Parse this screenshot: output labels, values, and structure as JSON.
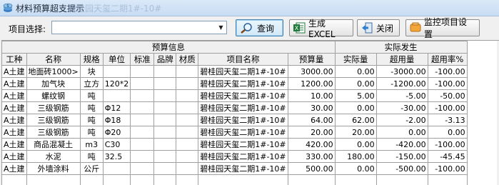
{
  "window": {
    "title": "材料预算超支提示",
    "title_ghost": "碧桂园天玺二期1#-10#"
  },
  "toolbar": {
    "select_label": "项目选择:",
    "select_value": "",
    "query_label": "查询",
    "excel_label": "生成EXCEL",
    "close_label": "关闭",
    "monitor_label": "监控项目设置"
  },
  "table": {
    "group_headers": {
      "budget": "预算信息",
      "actual": "实际发生"
    },
    "columns": [
      "工种",
      "名称",
      "规格",
      "单位",
      "标准",
      "品牌",
      "材质",
      "项目名称",
      "预算量",
      "实际量",
      "超用量",
      "超用率%"
    ],
    "rows": [
      [
        "A土建",
        "地面砖1000>",
        "块",
        "",
        "",
        "",
        "",
        "碧桂园天玺二期1#-10#",
        "3000.00",
        "0.00",
        "-3000.00",
        "-100.00"
      ],
      [
        "A土建",
        "加气块",
        "立方",
        "120*2",
        "",
        "",
        "",
        "碧桂园天玺二期1#-10#",
        "1200.00",
        "0.00",
        "-1200.00",
        "-100.00"
      ],
      [
        "A土建",
        "螺纹钢",
        "吨",
        "",
        "",
        "",
        "",
        "碧桂园天玺二期1#-10#",
        "10.00",
        "5.00",
        "-5.00",
        "-50.00"
      ],
      [
        "A土建",
        "三级钢筋",
        "吨",
        "Φ12",
        "",
        "",
        "",
        "碧桂园天玺二期1#-10#",
        "30.00",
        "0.00",
        "-30.00",
        "-100.00"
      ],
      [
        "A土建",
        "三级钢筋",
        "吨",
        "Φ18",
        "",
        "",
        "",
        "碧桂园天玺二期1#-10#",
        "64.00",
        "62.00",
        "-2.00",
        "-3.13"
      ],
      [
        "A土建",
        "三级钢筋",
        "吨",
        "Φ20",
        "",
        "",
        "",
        "碧桂园天玺二期1#-10#",
        "20.00",
        "20.00",
        "0.00",
        "0.00"
      ],
      [
        "A土建",
        "商品混凝土",
        "m3",
        "C30",
        "",
        "",
        "",
        "碧桂园天玺二期1#-10#",
        "420.00",
        "0.00",
        "-420.00",
        "-100.00"
      ],
      [
        "A土建",
        "水泥",
        "吨",
        "32.5",
        "",
        "",
        "",
        "碧桂园天玺二期1#-10#",
        "330.00",
        "180.00",
        "-150.00",
        "-45.45"
      ],
      [
        "A土建",
        "外墙涂料",
        "公斤",
        "",
        "",
        "",
        "",
        "碧桂园天玺二期1#-10#",
        "500.00",
        "0.00",
        "-500.00",
        "-100.00"
      ],
      [
        "",
        "",
        "",
        "",
        "",
        "",
        "",
        "",
        "",
        "",
        "",
        ""
      ]
    ]
  },
  "icons": {
    "app": "coin-stack-icon",
    "query": "magnifier-icon",
    "excel": "excel-icon",
    "close": "exit-door-icon",
    "monitor": "monitor-settings-icon"
  },
  "colors": {
    "excel_green": "#1e7a3a",
    "title_bar": "#c7dcf3"
  }
}
